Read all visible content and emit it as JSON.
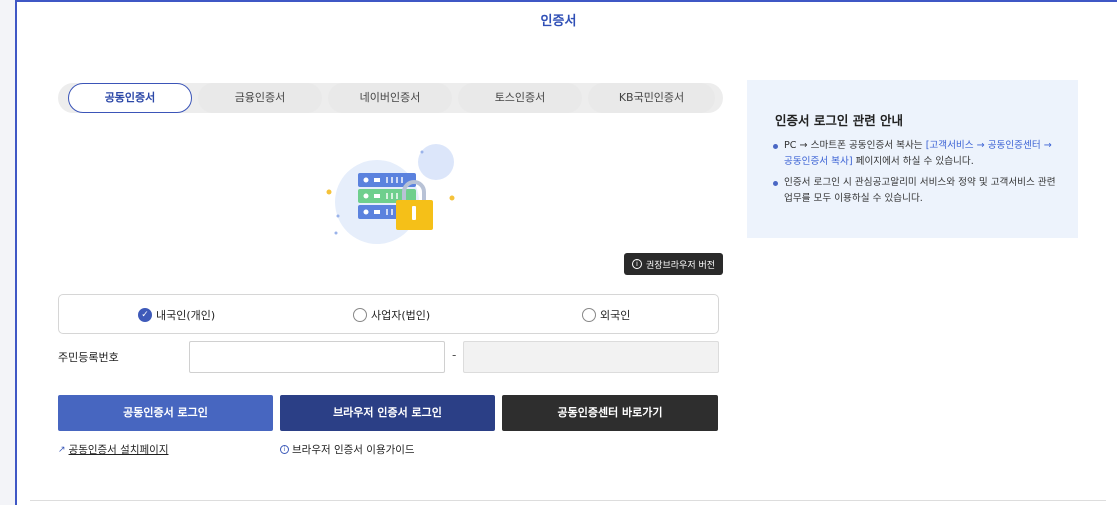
{
  "page": {
    "title": "인증서"
  },
  "tabs": [
    {
      "label": "공동인증서",
      "active": true
    },
    {
      "label": "금융인증서",
      "active": false
    },
    {
      "label": "네이버인증서",
      "active": false
    },
    {
      "label": "토스인증서",
      "active": false
    },
    {
      "label": "KB국민인증서",
      "active": false
    }
  ],
  "illustration": {
    "icon": "server-lock-icon"
  },
  "browser_badge": {
    "label": "권장브라우저 버전",
    "icon": "info-icon"
  },
  "user_type": {
    "options": [
      {
        "label": "내국인(개인)",
        "checked": true
      },
      {
        "label": "사업자(법인)",
        "checked": false
      },
      {
        "label": "외국인",
        "checked": false
      }
    ]
  },
  "resident_number": {
    "label": "주민등록번호",
    "first_value": "",
    "second_value": "",
    "separator": "-"
  },
  "buttons": {
    "cert_login": "공동인증서 로그인",
    "browser_cert_login": "브라우저 인증서 로그인",
    "go_cert_center": "공동인증센터 바로가기"
  },
  "links": {
    "install_page": "공동인증서 설치페이지",
    "browser_guide": "브라우저 인증서 이용가이드"
  },
  "info_panel": {
    "title": "인증서 로그인 관련 안내",
    "item1_prefix": "PC → 스마트폰 공동인증서 복사는 ",
    "item1_link": "[고객서비스 → 공동인증센터 → 공동인증서 복사]",
    "item1_suffix": " 페이지에서 하실 수 있습니다.",
    "item2": "인증서 로그인 시 관심공고알리미 서비스와 정약 및 고객서비스 관련업무를 모두 이용하실 수 있습니다."
  },
  "colors": {
    "primary": "#4766c0",
    "dark_navy": "#2b3f86",
    "dark": "#2e2e2e",
    "panel_bg": "#edf3fc"
  }
}
